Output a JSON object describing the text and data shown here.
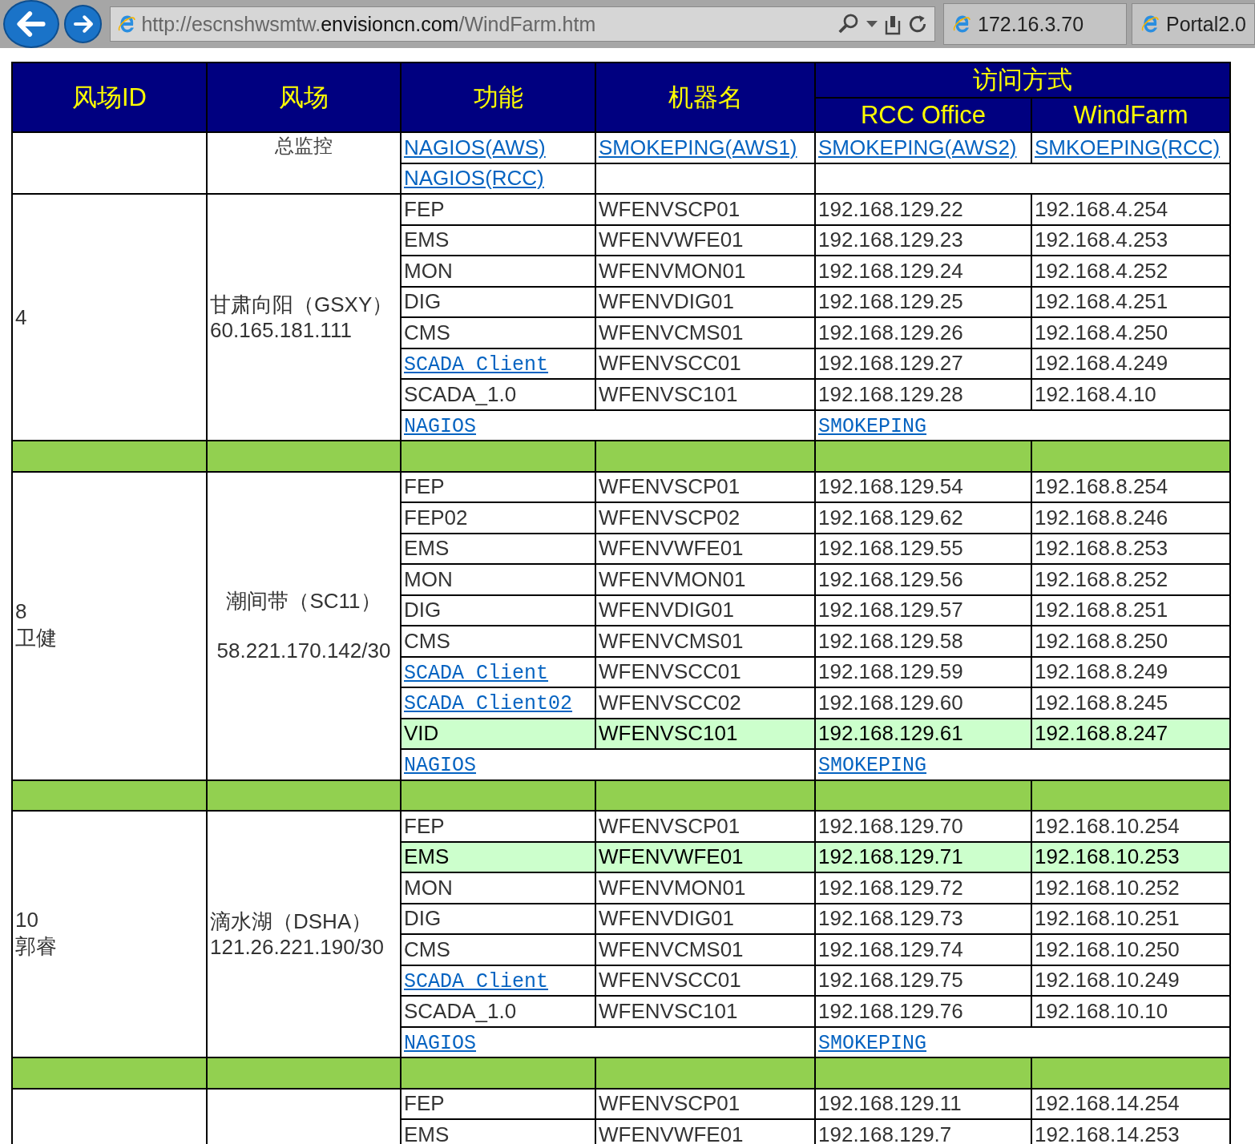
{
  "browser": {
    "url": {
      "prefix": "http://escnshwsmtw.",
      "domain": "envisioncn.com",
      "path": "/WindFarm.htm"
    },
    "tabs": [
      {
        "title": "172.16.3.70"
      },
      {
        "title": "Portal2.0"
      }
    ]
  },
  "table": {
    "columns": [
      "风场ID",
      "风场",
      "功能",
      "机器名"
    ],
    "access_group": "访问方式",
    "access_columns": [
      "RCC Office",
      "WindFarm"
    ],
    "overview": {
      "name": "总监控",
      "rows": [
        [
          "NAGIOS(AWS)",
          "SMOKEPING(AWS1)",
          "SMOKEPING(AWS2)",
          "SMKOEPING(RCC)"
        ],
        [
          "NAGIOS(RCC)"
        ]
      ]
    },
    "farms": [
      {
        "id_lines": [
          "4"
        ],
        "name_lines": [
          "甘肃向阳（GSXY）",
          "60.165.181.111"
        ],
        "centered": false,
        "rows": [
          {
            "kind": "text",
            "function": "FEP",
            "machine": "WFENVSCP01",
            "rcc": "192.168.129.22",
            "windfarm": "192.168.4.254",
            "highlighted": false
          },
          {
            "kind": "text",
            "function": "EMS",
            "machine": "WFENVWFE01",
            "rcc": "192.168.129.23",
            "windfarm": "192.168.4.253",
            "highlighted": false
          },
          {
            "kind": "text",
            "function": "MON",
            "machine": "WFENVMON01",
            "rcc": "192.168.129.24",
            "windfarm": "192.168.4.252",
            "highlighted": false
          },
          {
            "kind": "text",
            "function": "DIG",
            "machine": "WFENVDIG01",
            "rcc": "192.168.129.25",
            "windfarm": "192.168.4.251",
            "highlighted": false
          },
          {
            "kind": "text",
            "function": "CMS",
            "machine": "WFENVCMS01",
            "rcc": "192.168.129.26",
            "windfarm": "192.168.4.250",
            "highlighted": false
          },
          {
            "kind": "link",
            "function": "SCADA_Client",
            "machine": "WFENVSCC01",
            "rcc": "192.168.129.27",
            "windfarm": "192.168.4.249",
            "highlighted": false
          },
          {
            "kind": "text",
            "function": "SCADA_1.0",
            "machine": "WFENVSC101",
            "rcc": "192.168.129.28",
            "windfarm": "192.168.4.10",
            "highlighted": false
          }
        ],
        "footer": [
          "NAGIOS",
          "SMOKEPING"
        ]
      },
      {
        "id_lines": [
          "8",
          "卫健"
        ],
        "name_lines": [
          "潮间带（SC11）",
          "58.221.170.142/30"
        ],
        "centered": true,
        "rows": [
          {
            "kind": "text",
            "function": "FEP",
            "machine": "WFENVSCP01",
            "rcc": "192.168.129.54",
            "windfarm": "192.168.8.254",
            "highlighted": false
          },
          {
            "kind": "text",
            "function": "FEP02",
            "machine": "WFENVSCP02",
            "rcc": "192.168.129.62",
            "windfarm": "192.168.8.246",
            "highlighted": false
          },
          {
            "kind": "text",
            "function": "EMS",
            "machine": "WFENVWFE01",
            "rcc": "192.168.129.55",
            "windfarm": "192.168.8.253",
            "highlighted": false
          },
          {
            "kind": "text",
            "function": "MON",
            "machine": "WFENVMON01",
            "rcc": "192.168.129.56",
            "windfarm": "192.168.8.252",
            "highlighted": false
          },
          {
            "kind": "text",
            "function": "DIG",
            "machine": "WFENVDIG01",
            "rcc": "192.168.129.57",
            "windfarm": "192.168.8.251",
            "highlighted": false
          },
          {
            "kind": "text",
            "function": "CMS",
            "machine": "WFENVCMS01",
            "rcc": "192.168.129.58",
            "windfarm": "192.168.8.250",
            "highlighted": false
          },
          {
            "kind": "link",
            "function": "SCADA_Client",
            "machine": "WFENVSCC01",
            "rcc": "192.168.129.59",
            "windfarm": "192.168.8.249",
            "highlighted": false
          },
          {
            "kind": "link",
            "function": "SCADA_Client02",
            "machine": "WFENVSCC02",
            "rcc": "192.168.129.60",
            "windfarm": "192.168.8.245",
            "highlighted": false
          },
          {
            "kind": "text",
            "function": "VID",
            "machine": "WFENVSC101",
            "rcc": "192.168.129.61",
            "windfarm": "192.168.8.247",
            "highlighted": true
          }
        ],
        "footer": [
          "NAGIOS",
          "SMOKEPING"
        ]
      },
      {
        "id_lines": [
          "10",
          "郭睿"
        ],
        "name_lines": [
          "滴水湖（DSHA）",
          "121.26.221.190/30"
        ],
        "centered": false,
        "rows": [
          {
            "kind": "text",
            "function": "FEP",
            "machine": "WFENVSCP01",
            "rcc": "192.168.129.70",
            "windfarm": "192.168.10.254",
            "highlighted": false
          },
          {
            "kind": "text",
            "function": "EMS",
            "machine": "WFENVWFE01",
            "rcc": "192.168.129.71",
            "windfarm": "192.168.10.253",
            "highlighted": true
          },
          {
            "kind": "text",
            "function": "MON",
            "machine": "WFENVMON01",
            "rcc": "192.168.129.72",
            "windfarm": "192.168.10.252",
            "highlighted": false
          },
          {
            "kind": "text",
            "function": "DIG",
            "machine": "WFENVDIG01",
            "rcc": "192.168.129.73",
            "windfarm": "192.168.10.251",
            "highlighted": false
          },
          {
            "kind": "text",
            "function": "CMS",
            "machine": "WFENVCMS01",
            "rcc": "192.168.129.74",
            "windfarm": "192.168.10.250",
            "highlighted": false
          },
          {
            "kind": "link",
            "function": "SCADA_Client",
            "machine": "WFENVSCC01",
            "rcc": "192.168.129.75",
            "windfarm": "192.168.10.249",
            "highlighted": false
          },
          {
            "kind": "text",
            "function": "SCADA_1.0",
            "machine": "WFENVSC101",
            "rcc": "192.168.129.76",
            "windfarm": "192.168.10.10",
            "highlighted": false
          }
        ],
        "footer": [
          "NAGIOS",
          "SMOKEPING"
        ]
      },
      {
        "rows": [
          {
            "kind": "text",
            "function": "FEP",
            "machine": "WFENVSCP01",
            "rcc": "192.168.129.11",
            "windfarm": "192.168.14.254",
            "highlighted": false
          },
          {
            "kind": "text",
            "function": "EMS",
            "machine": "WFENVWFE01",
            "rcc": "192.168.129.7",
            "windfarm": "192.168.14.253",
            "highlighted": false
          }
        ]
      }
    ]
  }
}
